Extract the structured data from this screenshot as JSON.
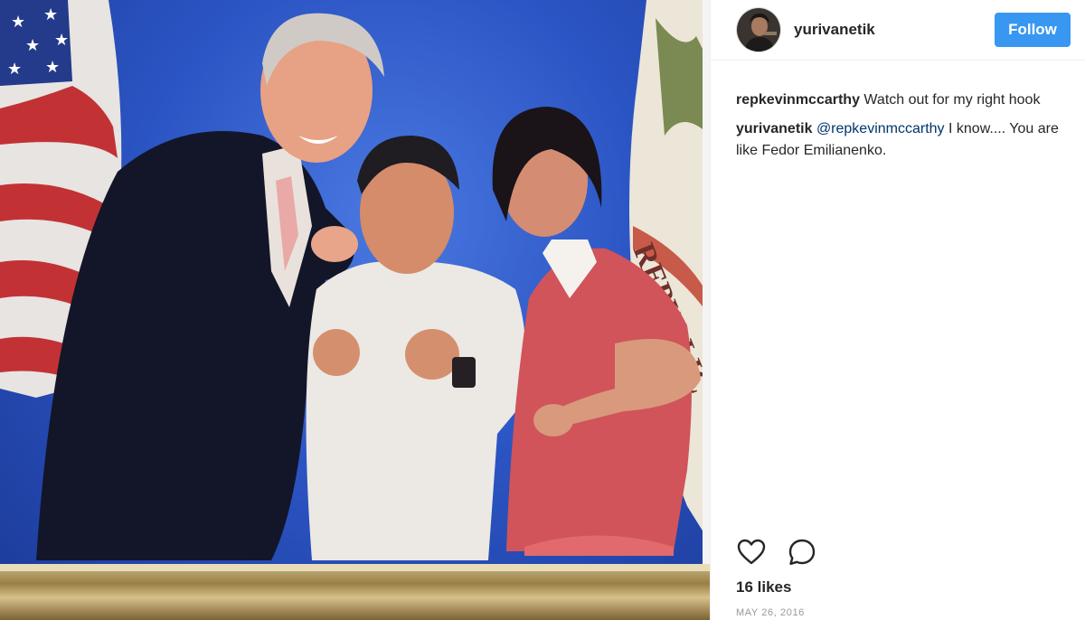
{
  "post": {
    "author": {
      "username": "yurivanetik",
      "avatar_icon": "profile-photo"
    },
    "follow_label": "Follow",
    "comments": [
      {
        "author": "repkevinmccarthy",
        "text": " Watch out for my right hook"
      },
      {
        "author": "yurivanetik",
        "mention": "@repkevinmccarthy",
        "text": " I know.... You are like Fedor Emilianenko."
      }
    ],
    "actions": {
      "like_icon": "heart-outline-icon",
      "comment_icon": "comment-bubble-icon"
    },
    "likes": "16 likes",
    "date": "MAY 26, 2016",
    "photo": {
      "flag_text": "REPUBLIC"
    }
  },
  "colors": {
    "follow_button": "#3897f0",
    "mention": "#003569",
    "photo_background": "#2b55c4"
  }
}
